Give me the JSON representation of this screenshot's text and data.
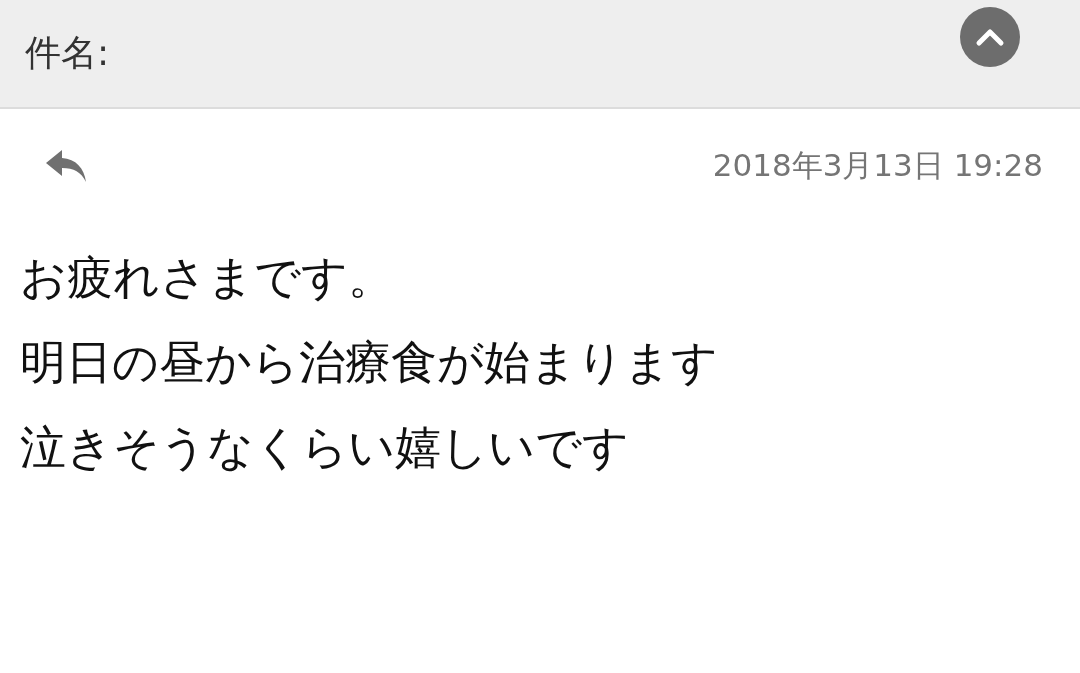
{
  "header": {
    "subject_label": "件名:"
  },
  "message": {
    "date": "2018年3月13日 19:28",
    "lines": [
      "お疲れさまです。",
      "明日の昼から治療食が始まります",
      "泣きそうなくらい嬉しいです"
    ]
  }
}
